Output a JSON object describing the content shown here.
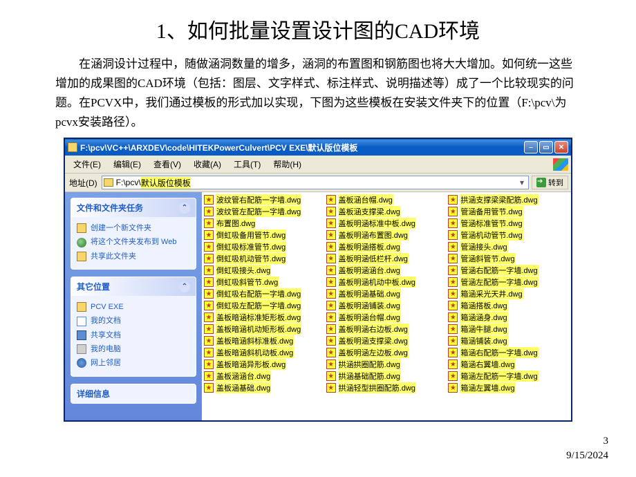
{
  "title": "1、如何批量设置设计图的CAD环境",
  "paragraph": "在涵洞设计过程中，随做涵洞数量的增多，涵洞的布置图和钢筋图也将大大增加。如何统一这些增加的成果图的CAD环境（包括：图层、文字样式、标注样式、说明描述等）成了一个比较现实的问题。在PCVX中，我们通过模板的形式加以实现，下图为这些模板在安装文件夹下的位置（F:\\pcv\\为pcvx安装路径）。",
  "explorer": {
    "titlebar": "F:\\pcv\\VC++\\ARXDEV\\code\\HITEKPowerCulvert\\PCV EXE\\默认版位模板",
    "menu": {
      "file": "文件(E)",
      "edit": "编辑(E)",
      "view": "查看(V)",
      "fav": "收藏(A)",
      "tools": "工具(T)",
      "help": "帮助(H)"
    },
    "addr_label": "地址(D)",
    "addr_prefix": "F:\\pcv\\",
    "addr_highlight": "默认版位模板",
    "go_label": "转到",
    "sidebar": {
      "tasks_header": "文件和文件夹任务",
      "tasks": {
        "new_folder": "创建一个新文件夹",
        "publish": "将这个文件夹发布到 Web",
        "share": "共享此文件夹"
      },
      "other_header": "其它位置",
      "other": {
        "pcvexe": "PCV EXE",
        "mydocs": "我的文档",
        "shared": "共享文档",
        "mycomp": "我的电脑",
        "netplaces": "网上邻居"
      },
      "details_header": "详细信息"
    },
    "files": {
      "col1": [
        "波纹管右配筋一字墙.dwg",
        "波纹管左配筋一字墙.dwg",
        "布置图.dwg",
        "倒虹吸备用管节.dwg",
        "倒虹吸标准管节.dwg",
        "倒虹吸机动管节.dwg",
        "倒虹吸接头.dwg",
        "倒虹吸斜管节.dwg",
        "倒虹吸右配筋一字墙.dwg",
        "倒虹吸左配筋一字墙.dwg",
        "盖板暗涵标准矩形板.dwg",
        "盖板暗涵机动矩形板.dwg",
        "盖板暗涵斜标准板.dwg",
        "盖板暗涵斜机动板.dwg",
        "盖板暗涵异形板.dwg",
        "盖板涵涵台.dwg",
        "盖板涵基础.dwg"
      ],
      "col2": [
        "盖板涵台帽.dwg",
        "盖板涵支撑梁.dwg",
        "盖板明涵标准中板.dwg",
        "盖板明涵布置图.dwg",
        "盖板明涵搭板.dwg",
        "盖板明涵低栏杆.dwg",
        "盖板明涵涵台.dwg",
        "盖板明涵机动中板.dwg",
        "盖板明涵基础.dwg",
        "盖板明涵铺装.dwg",
        "盖板明涵台帽.dwg",
        "盖板明涵右边板.dwg",
        "盖板明涵支撑梁.dwg",
        "盖板明涵左边板.dwg",
        "拱涵拱圈配筋.dwg",
        "拱涵基础配筋.dwg",
        "拱涵轻型拱圈配筋.dwg"
      ],
      "col3": [
        "拱涵支撑梁梁配筋.dwg",
        "管涵备用管节.dwg",
        "管涵标准管节.dwg",
        "管涵机动管节.dwg",
        "管涵接头.dwg",
        "管涵斜管节.dwg",
        "管涵右配筋一字墙.dwg",
        "管涵左配筋一字墙.dwg",
        "箱涵采光天井.dwg",
        "箱涵搭板.dwg",
        "箱涵涵身.dwg",
        "箱涵牛腿.dwg",
        "箱涵铺装.dwg",
        "箱涵右配筋一字墙.dwg",
        "箱涵右翼墙.dwg",
        "箱涵左配筋一字墙.dwg",
        "箱涵左翼墙.dwg"
      ]
    }
  },
  "footer": {
    "page": "3",
    "date": "9/15/2024"
  }
}
